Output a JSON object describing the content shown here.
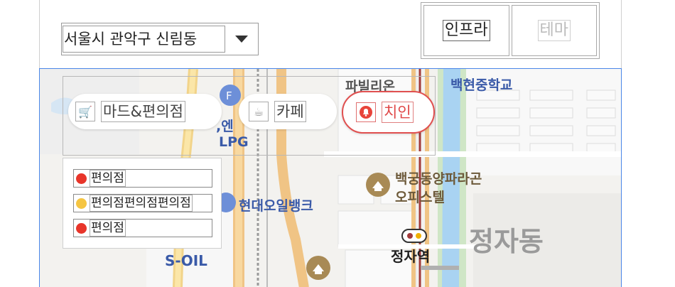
{
  "region": {
    "label": "서울시 관악구 신림동"
  },
  "tabs": [
    {
      "label": "인프라",
      "active": true
    },
    {
      "label": "테마",
      "active": false
    }
  ],
  "categories": [
    {
      "label": "마드&편의점",
      "icon": "cart-icon"
    },
    {
      "label": "카페",
      "icon": "coffee-icon"
    },
    {
      "label": "치인",
      "icon": "bell-icon",
      "active": true
    }
  ],
  "legend": [
    {
      "label": "편의점",
      "color": "#e8352a"
    },
    {
      "label": "편의점편의점편의점",
      "color": "#f5c542"
    },
    {
      "label": "편의점",
      "color": "#e8352a"
    }
  ],
  "map_labels": {
    "pavilion": "파빌리온",
    "school": "백현중학교",
    "lpg_partial": ",엔",
    "lpg": "LPG",
    "oilbank": "현대오일뱅크",
    "paragon": "백궁동양파라곤",
    "officetel": "오피스텔",
    "station": "정자역",
    "district": "정자동",
    "soil": "S-OIL"
  },
  "colors": {
    "accent": "#e05050",
    "map_border": "#4a86e8"
  }
}
